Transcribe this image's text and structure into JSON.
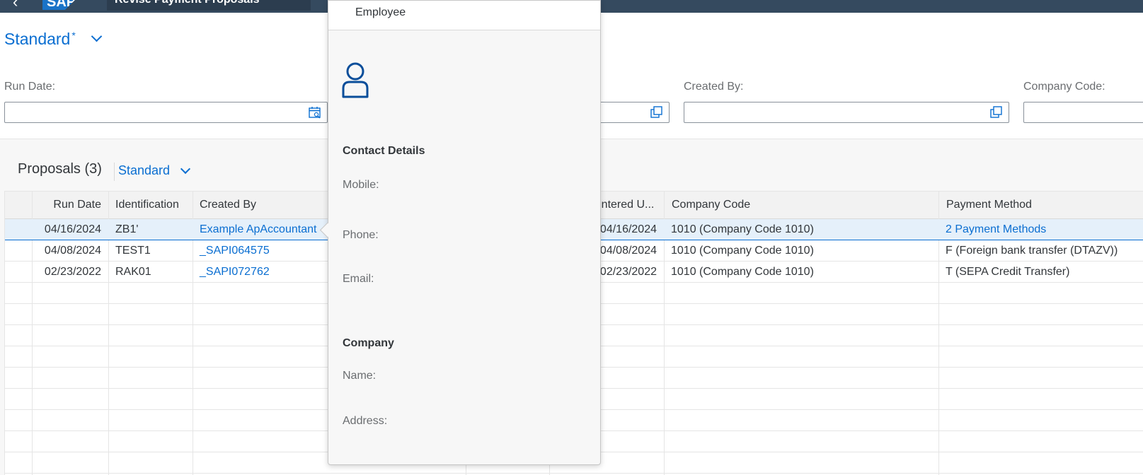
{
  "shell": {
    "app_title": "Revise Payment Proposals",
    "logo_text": "SAP",
    "brand_color": "#354a5f"
  },
  "filterbar": {
    "variant": "Standard",
    "variant_modified": "*",
    "fields": [
      {
        "label": "Run Date:",
        "value": ""
      },
      {
        "label": "",
        "value": ""
      },
      {
        "label": "Created By:",
        "value": ""
      },
      {
        "label": "Company Code:",
        "value": ""
      }
    ]
  },
  "table": {
    "title": "Proposals (3)",
    "variant": "Standard",
    "columns": [
      "Run Date",
      "Identification",
      "Created By",
      "Entered U...",
      "Company Code",
      "Payment Method"
    ],
    "rows": [
      {
        "run_date": "04/16/2024",
        "identification": "ZB1'",
        "created_by": "Example ApAccountant",
        "entered_on": "04/16/2024",
        "company_code": "1010 (Company Code 1010)",
        "payment_method": "2 Payment Methods",
        "selected": true
      },
      {
        "run_date": "04/08/2024",
        "identification": "TEST1",
        "created_by": "_SAPI064575",
        "entered_on": "04/08/2024",
        "company_code": "1010 (Company Code 1010)",
        "payment_method": "F (Foreign bank transfer (DTAZV))",
        "selected": false
      },
      {
        "run_date": "02/23/2022",
        "identification": "RAK01",
        "created_by": "_SAPI072762",
        "entered_on": "02/23/2022",
        "company_code": "1010 (Company Code 1010)",
        "payment_method": "T (SEPA Credit Transfer)",
        "selected": false
      }
    ],
    "accent_color": "#0a6ed1"
  },
  "popover": {
    "header": "Employee",
    "avatar_icon": "person-icon",
    "contact_section": "Contact Details",
    "mobile_label": "Mobile:",
    "phone_label": "Phone:",
    "email_label": "Email:",
    "company_section": "Company",
    "name_label": "Name:",
    "address_label": "Address:"
  }
}
